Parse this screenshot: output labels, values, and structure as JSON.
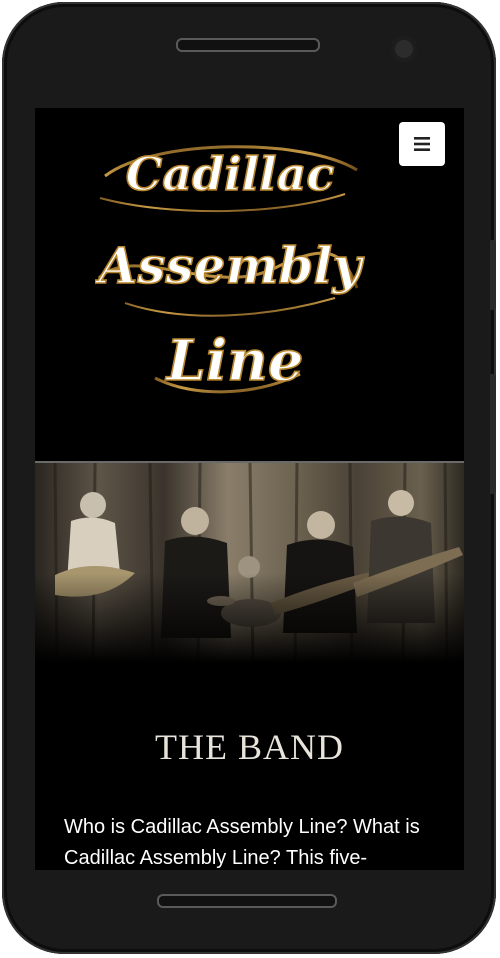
{
  "site": {
    "logo_lines": [
      "Cadillac",
      "Assembly",
      "Line"
    ]
  },
  "header": {
    "menu_icon": "hamburger-icon"
  },
  "hero": {
    "image_label": "band photo"
  },
  "section": {
    "title": "THE BAND",
    "body": "Who is Cadillac Assembly Line? What is Cadillac Assembly Line? This five-"
  },
  "colors": {
    "background": "#000000",
    "logo_text": "#ffffff",
    "logo_gold": "#b8862e",
    "title": "#e8e4dc"
  }
}
